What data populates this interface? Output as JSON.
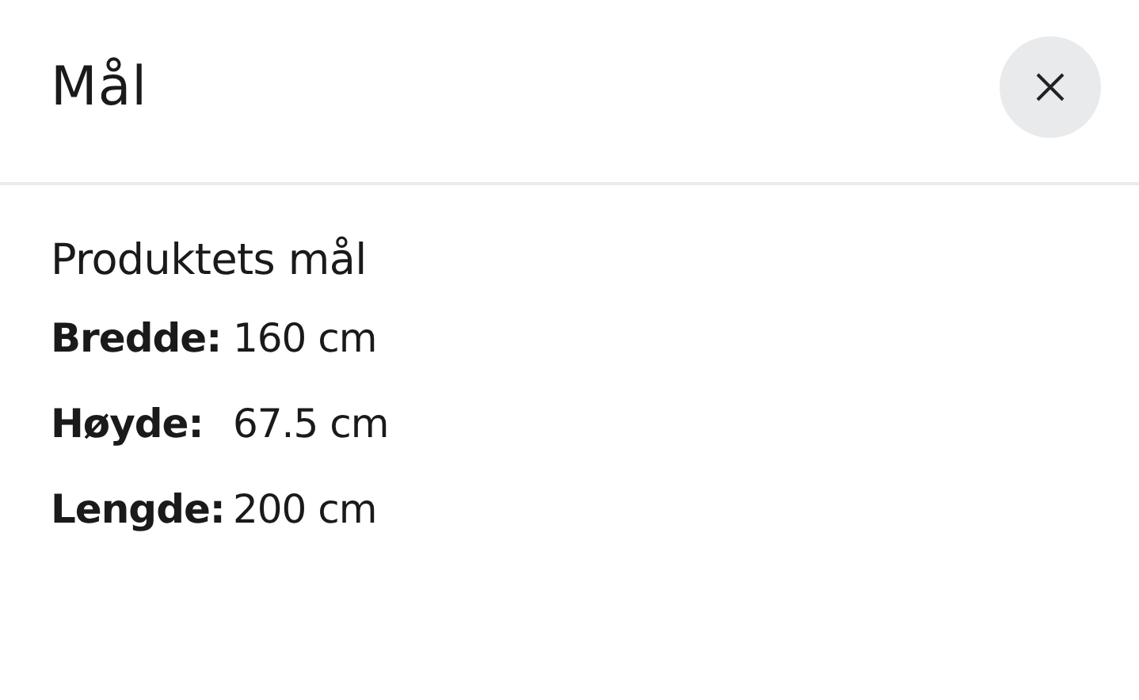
{
  "header": {
    "title": "Mål"
  },
  "section": {
    "heading": "Produktets mål",
    "rows": [
      {
        "label": "Bredde:",
        "value": "160 cm"
      },
      {
        "label": "Høyde:",
        "value": "67.5 cm"
      },
      {
        "label": "Lengde:",
        "value": "200 cm"
      }
    ]
  }
}
